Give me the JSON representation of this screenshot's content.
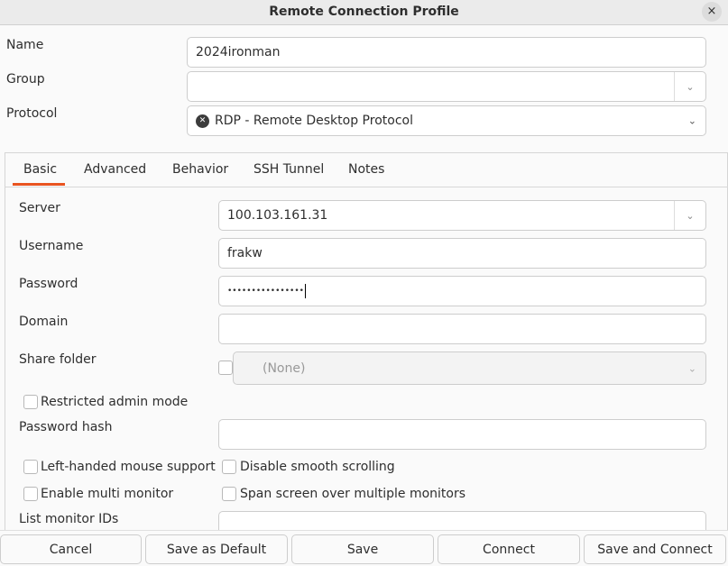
{
  "window": {
    "title": "Remote Connection Profile",
    "close_label": "×"
  },
  "profile": {
    "name_label": "Name",
    "name_value": "2024ironman",
    "group_label": "Group",
    "group_value": "",
    "protocol_label": "Protocol",
    "protocol_value": "RDP - Remote Desktop Protocol"
  },
  "tabs": [
    {
      "label": "Basic",
      "active": true
    },
    {
      "label": "Advanced"
    },
    {
      "label": "Behavior"
    },
    {
      "label": "SSH Tunnel"
    },
    {
      "label": "Notes"
    }
  ],
  "basic": {
    "server_label": "Server",
    "server_value": "100.103.161.31",
    "username_label": "Username",
    "username_value": "frakw",
    "password_label": "Password",
    "password_value": "••••••••••••••••",
    "domain_label": "Domain",
    "domain_value": "",
    "share_folder_label": "Share folder",
    "share_folder_value": "(None)",
    "restricted_admin_label": "Restricted admin mode",
    "password_hash_label": "Password hash",
    "password_hash_value": "",
    "left_handed_label": "Left-handed mouse support",
    "disable_smooth_label": "Disable smooth scrolling",
    "multi_monitor_label": "Enable multi monitor",
    "span_screen_label": "Span screen over multiple monitors",
    "monitor_ids_label": "List monitor IDs",
    "monitor_ids_value": ""
  },
  "buttons": {
    "cancel": "Cancel",
    "save_default": "Save as Default",
    "save": "Save",
    "connect": "Connect",
    "save_connect": "Save and Connect"
  },
  "colors": {
    "accent": "#e95420"
  }
}
